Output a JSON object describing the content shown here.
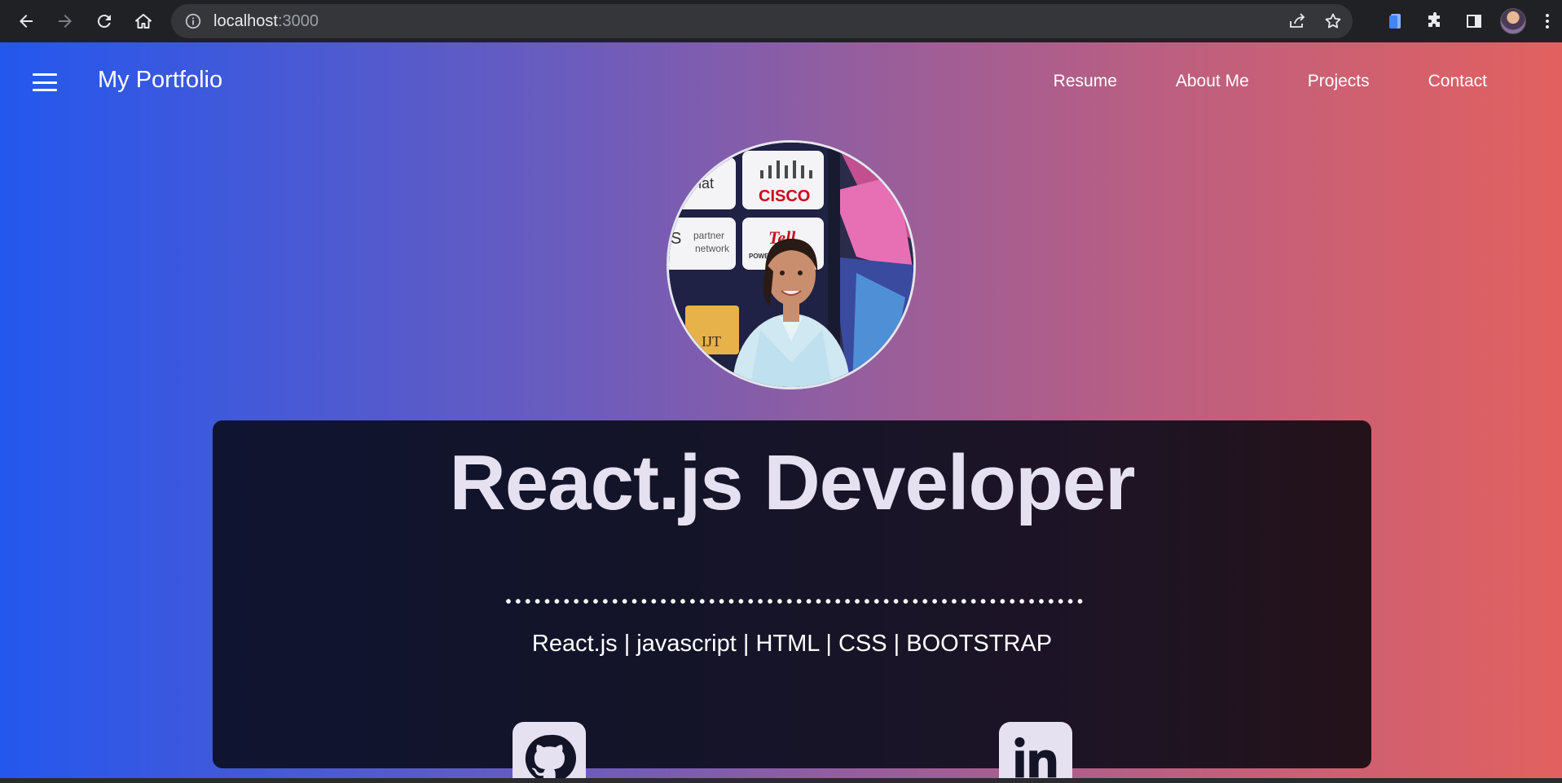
{
  "browser": {
    "url_host": "localhost",
    "url_port": ":3000",
    "icons": {
      "back": "back-arrow-icon",
      "forward": "forward-arrow-icon",
      "reload": "reload-icon",
      "home": "home-icon",
      "info": "info-icon",
      "share": "share-icon",
      "bookmark": "star-icon",
      "extension_doc": "document-icon",
      "extensions": "puzzle-icon",
      "side_panel": "side-panel-icon",
      "menu": "kebab-menu-icon"
    }
  },
  "navbar": {
    "brand": "My Portfolio",
    "links": [
      "Resume",
      "About Me",
      "Projects",
      "Contact"
    ]
  },
  "profile_photo": {
    "signs": [
      "hat",
      "CISCO",
      "partner",
      "network",
      "S",
      "Tell",
      "POWER",
      "IJT"
    ]
  },
  "hero": {
    "title": "React.js Developer",
    "skills": "React.js | javascript | HTML | CSS | BOOTSTRAP",
    "social": [
      {
        "name": "github-icon"
      },
      {
        "name": "linkedin-icon"
      }
    ]
  },
  "colors": {
    "gradient_start": "#2457ee",
    "gradient_end": "#e2615f",
    "card_bg": "#141428",
    "title_text": "#e6e1f0"
  }
}
